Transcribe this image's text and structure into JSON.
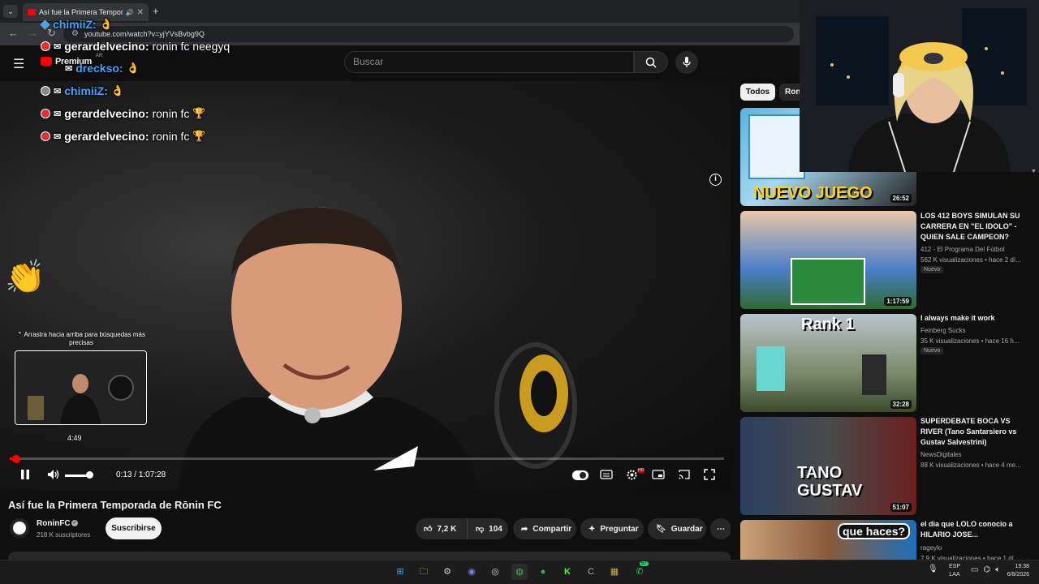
{
  "browser": {
    "tab_title": "Así fue la Primera Tempora",
    "url": "youtube.com/watch?v=yjYVsBvbg9Q"
  },
  "youtube": {
    "logo_text": "Premium",
    "country": "AR",
    "search_placeholder": "Buscar"
  },
  "chat": [
    {
      "user": "chimiiZ:",
      "msg": "",
      "emote": "👌"
    },
    {
      "user": "gerardelvecino:",
      "msg": "ronin fc neegyq",
      "emote": ""
    },
    {
      "user": "dreckso:",
      "msg": "",
      "emote": "👌"
    },
    {
      "user": "chimiiZ:",
      "msg": "",
      "emote": "👌"
    },
    {
      "user": "gerardelvecino:",
      "msg": "ronin fc",
      "emote": "🏆"
    },
    {
      "user": "gerardelvecino:",
      "msg": "ronin fc",
      "emote": "🏆"
    }
  ],
  "player": {
    "hint": "⌃ Arrastra hacia arriba para búsquedas más precisas",
    "preview_time": "4:49",
    "current_time": "0:13",
    "duration": "1:07:28",
    "progress_fraction": 0.0032,
    "volume_fraction": 0.85
  },
  "video": {
    "title": "Así fue la Primera Temporada de Rōnin FC",
    "channel": "RoninFC",
    "subscribers": "218 K suscriptores",
    "subscribe_label": "Suscribirse",
    "likes": "7,2 K",
    "dislikes": "104",
    "share": "Compartir",
    "ask": "Preguntar",
    "save": "Guardar"
  },
  "sidebar": {
    "chips": [
      "Todos",
      "Ron"
    ],
    "items": [
      {
        "title": "",
        "channel": "",
        "meta": "",
        "duration": "26:52",
        "thumb_text": "NUEVO JUEGO",
        "new": ""
      },
      {
        "title": "LOS 412 BOYS SIMULAN SU CARRERA EN \"EL IDOLO\" - QUIEN SALE CAMPEON?",
        "channel": "412 - El Programa Del Fútbol",
        "meta": "562 K visualizaciones • hace 2 dí...",
        "duration": "1:17:59",
        "thumb_text": "",
        "new": "Nuevo"
      },
      {
        "title": "I always make it work",
        "channel": "Feinberg Sucks",
        "meta": "35 K visualizaciones • hace 16 h...",
        "duration": "32:28",
        "thumb_text": "Rank 1",
        "new": "Nuevo"
      },
      {
        "title": "SUPERDEBATE BOCA VS RIVER (Tano Santarsiero vs Gustav Salvestrini)",
        "channel": "NewsDigitales",
        "meta": "88 K visualizaciones • hace 4 me...",
        "duration": "51:07",
        "thumb_text": "TANO GUSTAV",
        "new": ""
      },
      {
        "title": "el dia que LOLO conocio a HILARIO JOSE...",
        "channel": "rageylo",
        "meta": "7,9 K visualizaciones • hace 1 dí...",
        "duration": "",
        "thumb_text": "que haces?",
        "new": ""
      }
    ]
  },
  "taskbar": {
    "lang": "ESP\nLAA",
    "time": "19:38",
    "date": "6/8/2026",
    "whatsapp_badge": "57"
  },
  "colors": {
    "accent": "#ff0000",
    "link": "#3ea6ff"
  }
}
